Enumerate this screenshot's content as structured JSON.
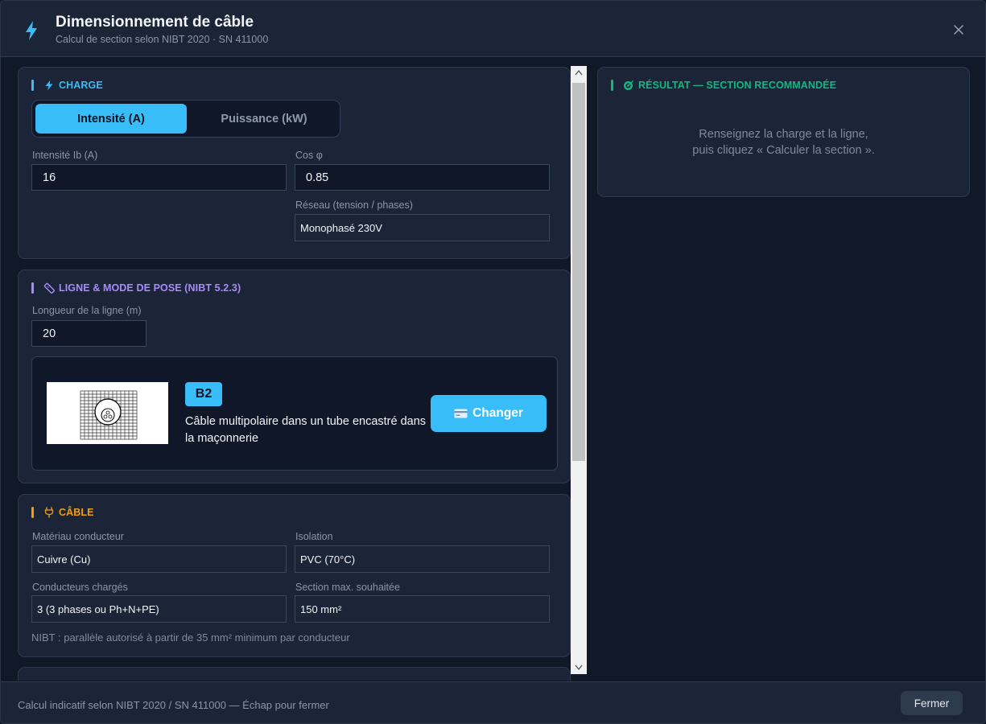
{
  "header": {
    "title": "Dimensionnement de câble",
    "subtitle": "Calcul de section selon NIBT 2020 · SN 411000",
    "icon": "lightning-bolt-icon",
    "close_icon": "close-icon"
  },
  "charge": {
    "title": "CHARGE",
    "icon": "lightning-bolt-icon",
    "accent": "#38bdf8",
    "toggle": {
      "active": "Intensité (A)",
      "inactive": "Puissance (kW)"
    },
    "current_label": "Intensité Ib (A)",
    "current_value": "16",
    "cos_label": "Cos φ",
    "cos_value": "0.85",
    "network_label": "Réseau (tension / phases)",
    "network_value": "Monophasé 230V"
  },
  "line": {
    "title": "LIGNE & MODE DE POSE (NIBT 5.2.3)",
    "icon": "ruler-icon",
    "accent": "#a78bfa",
    "length_label": "Longueur de la ligne (m)",
    "length_value": "20",
    "pose_code": "B2",
    "pose_description": "Câble multipolaire dans un tube encastré dans la maçonnerie",
    "change_button": "Changer",
    "change_icon": "card-icon"
  },
  "cable": {
    "title": "CÂBLE",
    "icon": "plug-icon",
    "accent": "#f59e0b",
    "material_label": "Matériau conducteur",
    "material_value": "Cuivre (Cu)",
    "insulation_label": "Isolation",
    "insulation_value": "PVC (70°C)",
    "conductors_label": "Conducteurs chargés",
    "conductors_value": "3 (3 phases ou Ph+N+PE)",
    "max_section_label": "Section max. souhaitée",
    "max_section_value": "150 mm²",
    "note": "NIBT : parallèle autorisé à partir de 35 mm² minimum par conducteur"
  },
  "result": {
    "title": "RÉSULTAT — SECTION RECOMMANDÉE",
    "icon": "target-icon",
    "accent": "#10b981",
    "message_line1": "Renseignez la charge et la ligne,",
    "message_line2": "puis cliquez « Calculer la section »."
  },
  "footer": {
    "text": "Calcul indicatif selon NIBT 2020 / SN 411000 — Échap pour fermer",
    "close_button": "Fermer"
  }
}
